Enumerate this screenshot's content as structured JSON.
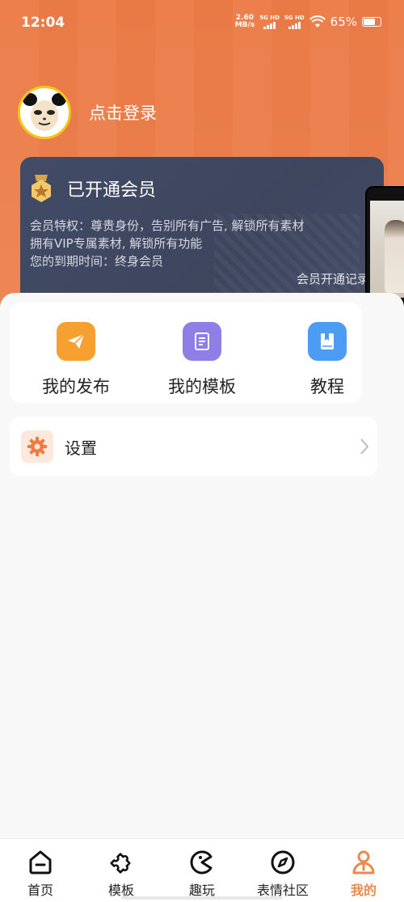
{
  "status_bar": {
    "time": "12:04",
    "speed_value": "2.60",
    "speed_unit": "MB/s",
    "sim1": "5G HD",
    "sim2": "5G HD",
    "battery": "65%"
  },
  "profile": {
    "login_text": "点击登录"
  },
  "vip_card": {
    "title": "已开通会员",
    "lines": [
      "会员特权：尊贵身份，告别所有广告, 解锁所有素材",
      "拥有VIP专属素材, 解锁所有功能",
      "您的到期时间：终身会员"
    ],
    "record_link": "会员开通记录"
  },
  "quick_actions": [
    {
      "label": "我的发布",
      "icon": "send-icon",
      "color": "#f5a030"
    },
    {
      "label": "我的模板",
      "icon": "template-icon",
      "color": "#8f7ee6"
    },
    {
      "label": "教程",
      "icon": "book-icon",
      "color": "#4d9cf4"
    }
  ],
  "settings": {
    "label": "设置",
    "icon": "gear-icon",
    "icon_color": "#f07a44"
  },
  "tabbar": {
    "items": [
      {
        "label": "首页",
        "icon": "home-icon",
        "active": false
      },
      {
        "label": "模板",
        "icon": "puzzle-icon",
        "active": false
      },
      {
        "label": "趣玩",
        "icon": "pacman-icon",
        "active": false
      },
      {
        "label": "表情社区",
        "icon": "compass-icon",
        "active": false
      },
      {
        "label": "我的",
        "icon": "user-icon",
        "active": true
      }
    ]
  },
  "colors": {
    "header_orange": "#ec7f4c",
    "vip_card_bg": "#424b66",
    "active_tab": "#ea8a4c"
  }
}
